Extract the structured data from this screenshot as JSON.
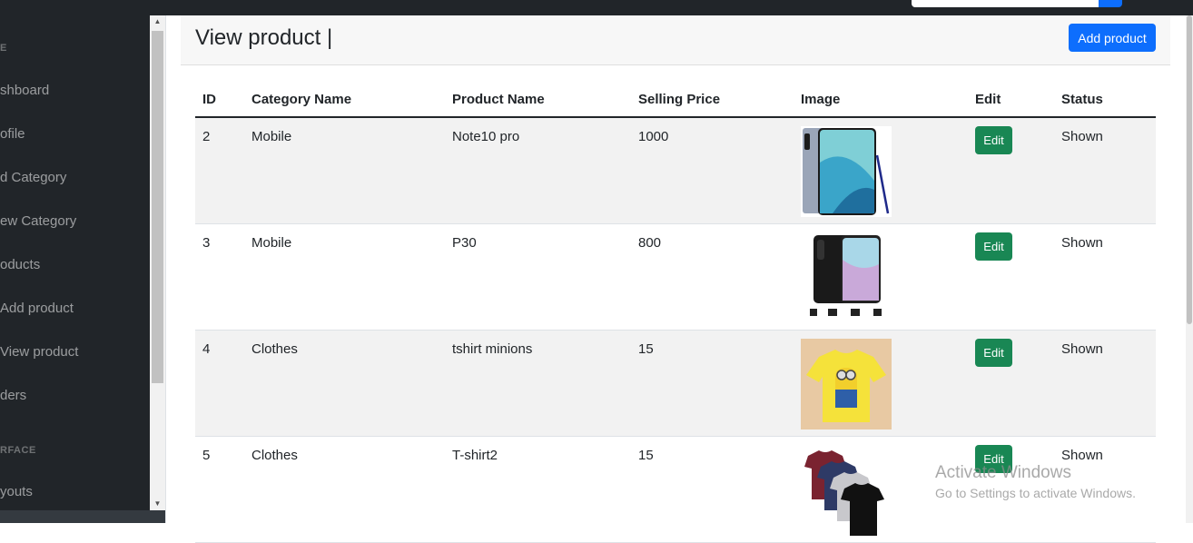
{
  "header": {
    "title": "View product |",
    "add_button": "Add product"
  },
  "sidebar": {
    "items": [
      {
        "kind": "heading",
        "label": "E"
      },
      {
        "kind": "item",
        "label": "shboard"
      },
      {
        "kind": "item",
        "label": "ofile"
      },
      {
        "kind": "item",
        "label": "d Category"
      },
      {
        "kind": "item",
        "label": "ew Category"
      },
      {
        "kind": "item",
        "label": "oducts"
      },
      {
        "kind": "item",
        "label": "Add product"
      },
      {
        "kind": "item",
        "label": "View product"
      },
      {
        "kind": "item",
        "label": "ders"
      },
      {
        "kind": "heading",
        "label": "RFACE"
      },
      {
        "kind": "item",
        "label": "youts"
      }
    ]
  },
  "table": {
    "columns": [
      "ID",
      "Category Name",
      "Product Name",
      "Selling Price",
      "Image",
      "Edit",
      "Status"
    ],
    "edit_label": "Edit",
    "rows": [
      {
        "id": "2",
        "category": "Mobile",
        "product": "Note10 pro",
        "price": "1000",
        "image": "phone-note10",
        "status": "Shown"
      },
      {
        "id": "3",
        "category": "Mobile",
        "product": "P30",
        "price": "800",
        "image": "phone-p30",
        "status": "Shown"
      },
      {
        "id": "4",
        "category": "Clothes",
        "product": "tshirt minions",
        "price": "15",
        "image": "tshirt-minion",
        "status": "Shown"
      },
      {
        "id": "5",
        "category": "Clothes",
        "product": "T-shirt2",
        "price": "15",
        "image": "tshirts-stack",
        "status": "Shown"
      }
    ]
  },
  "watermark": {
    "line1": "Activate Windows",
    "line2": "Go to Settings to activate Windows."
  },
  "colors": {
    "primary": "#0d6efd",
    "success": "#198754",
    "sidebar": "#212529"
  }
}
